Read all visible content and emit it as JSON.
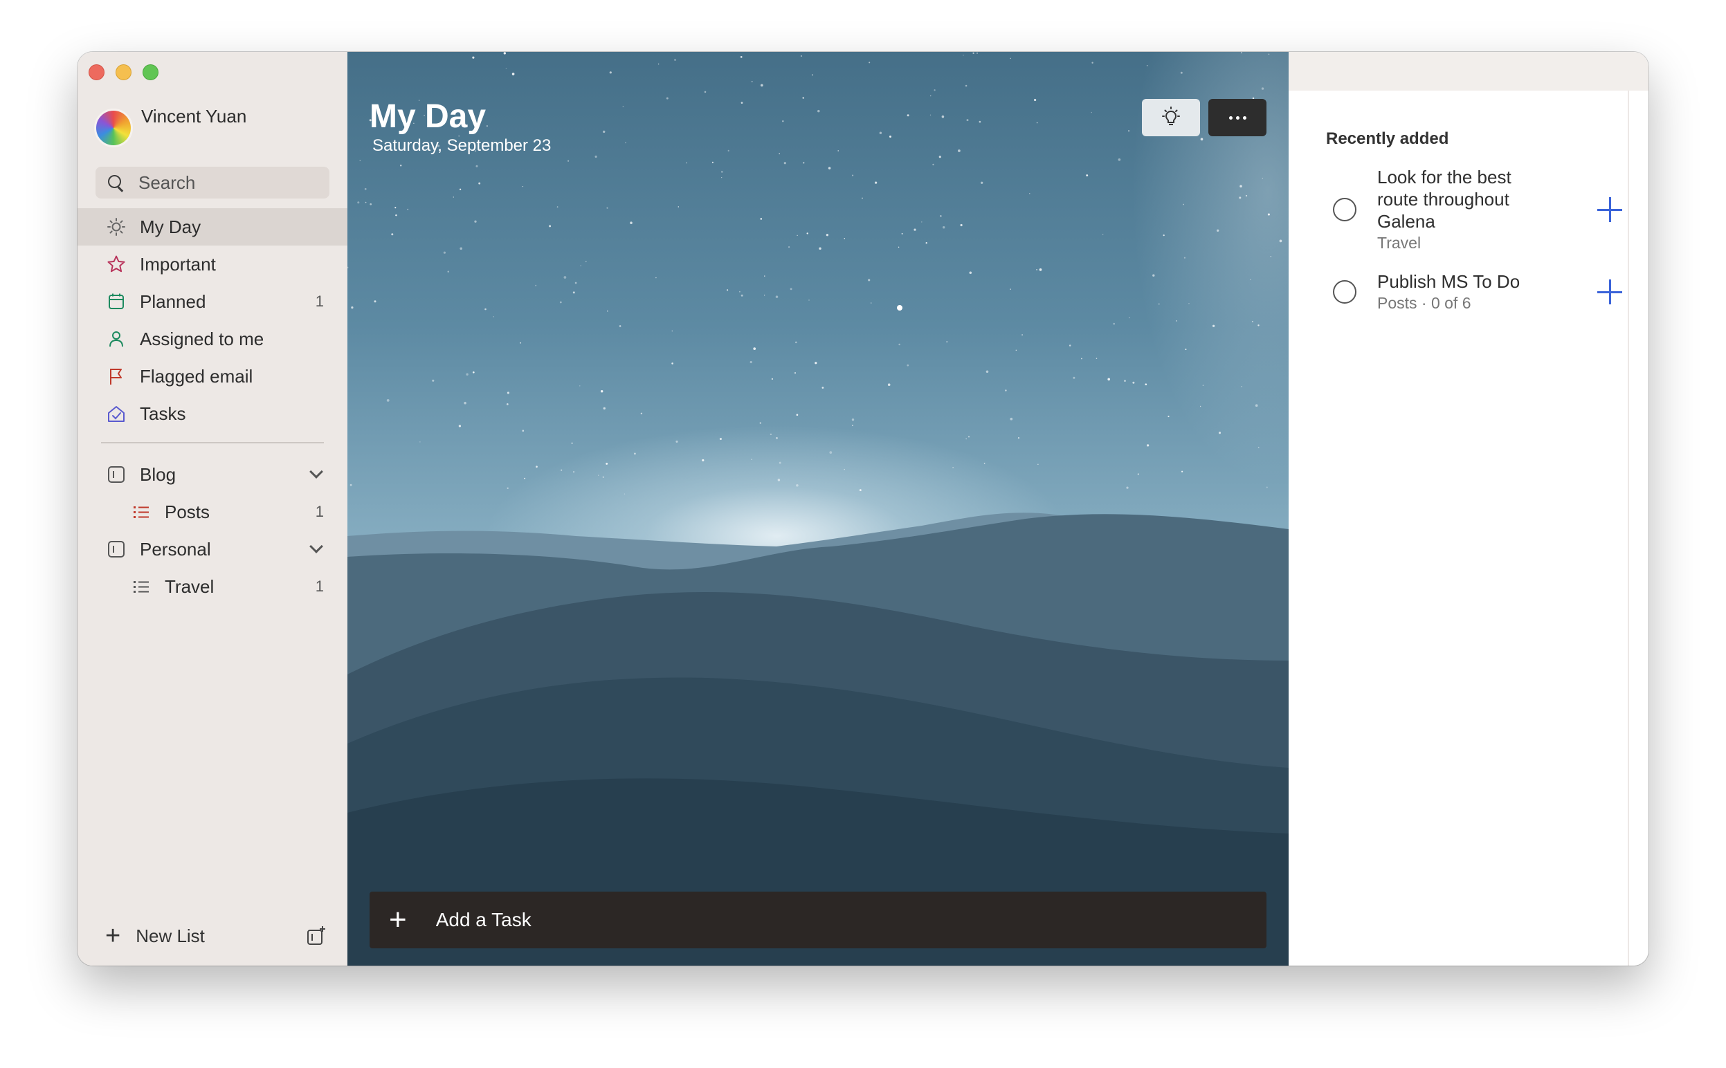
{
  "window": {
    "controls": [
      "close",
      "minimize",
      "maximize"
    ]
  },
  "sidebar": {
    "profile_name": "Vincent Yuan",
    "search_placeholder": "Search",
    "items": [
      {
        "label": "My Day",
        "icon": "sun-icon",
        "count": "",
        "active": true
      },
      {
        "label": "Important",
        "icon": "star-icon",
        "count": ""
      },
      {
        "label": "Planned",
        "icon": "calendar-icon",
        "count": "1"
      },
      {
        "label": "Assigned to me",
        "icon": "person-icon",
        "count": ""
      },
      {
        "label": "Flagged email",
        "icon": "flag-icon",
        "count": ""
      },
      {
        "label": "Tasks",
        "icon": "home-icon",
        "count": ""
      }
    ],
    "groups": [
      {
        "label": "Blog",
        "icon": "group-icon",
        "lists": [
          {
            "label": "Posts",
            "count": "1",
            "icon": "list-icon",
            "color": "#c0392b"
          }
        ]
      },
      {
        "label": "Personal",
        "icon": "group-icon",
        "lists": [
          {
            "label": "Travel",
            "count": "1",
            "icon": "list-icon",
            "color": "#555555"
          }
        ]
      }
    ],
    "new_list_label": "New List"
  },
  "main": {
    "title": "My Day",
    "date": "Saturday, September 23",
    "add_task_placeholder": "Add a Task"
  },
  "suggestions": {
    "heading": "Recently added",
    "items": [
      {
        "title": "Look for the best route throughout Galena",
        "meta": "Travel"
      },
      {
        "title": "Publish MS To Do",
        "meta": "Posts · 0 of 6"
      }
    ]
  },
  "colors": {
    "accent": "#3a63d9",
    "sidebar_bg": "#ede8e5",
    "add_task_bg": "#2c2725"
  }
}
